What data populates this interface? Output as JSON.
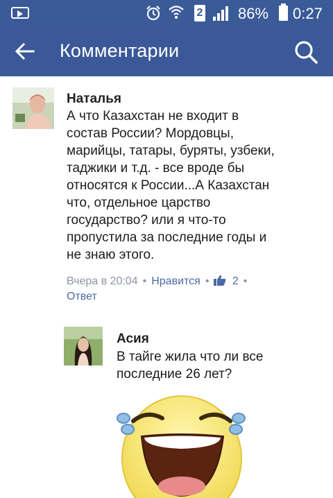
{
  "status_bar": {
    "sim_slot": "2",
    "battery_percent": "86%",
    "time": "0:27"
  },
  "app_bar": {
    "title": "Комментарии",
    "back_icon": "arrow-left-icon",
    "search_icon": "search-icon"
  },
  "comments": [
    {
      "author": "Наталья",
      "text": [
        "А что Казахстан не входит в",
        "состав России? Мордовцы,",
        "марийцы, татары, буряты, узбеки,",
        "таджики и т.д. - все вроде бы",
        "относятся к России...А Казахстан",
        "что, отдельное царство",
        "государство? или я что-то",
        "пропустила за последние годы и",
        "не знаю этого."
      ],
      "time": "Вчера в 20:04",
      "like_label": "Нравится",
      "like_count": "2",
      "reply_label": "Ответ"
    },
    {
      "author": "Асия",
      "text": [
        "В тайге жила что ли все",
        "последние 26 лет?"
      ]
    }
  ],
  "colors": {
    "facebook_blue": "#3b5998",
    "link": "#4a69a6",
    "meta_gray": "#8b93a6"
  }
}
